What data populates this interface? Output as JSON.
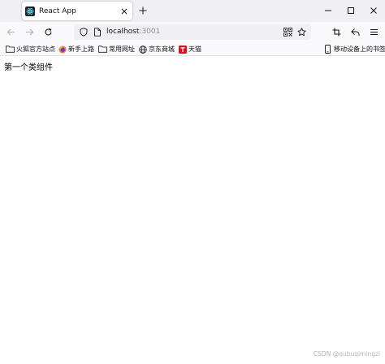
{
  "tab": {
    "title": "React App",
    "favicon": "react-icon"
  },
  "address": {
    "host": "localhost",
    "port": ":3001"
  },
  "bookmarks": [
    {
      "label": "火狐官方站点",
      "icon": "folder-icon"
    },
    {
      "label": "新手上路",
      "icon": "firefox-icon"
    },
    {
      "label": "常用网址",
      "icon": "folder-icon"
    },
    {
      "label": "京东商城",
      "icon": "globe-icon"
    },
    {
      "label": "天猫",
      "icon": "tmall-icon"
    },
    {
      "label": "移动设备上的书签",
      "icon": "mobile-icon"
    }
  ],
  "page": {
    "text": "第一个类组件"
  },
  "watermark": {
    "text": "CSDN @qubuqimingzi"
  },
  "colors": {
    "tabbar_bg": "#f0f0f4",
    "toolbar_bg": "#f9f9fb",
    "tmall_red": "#e00f1e"
  }
}
